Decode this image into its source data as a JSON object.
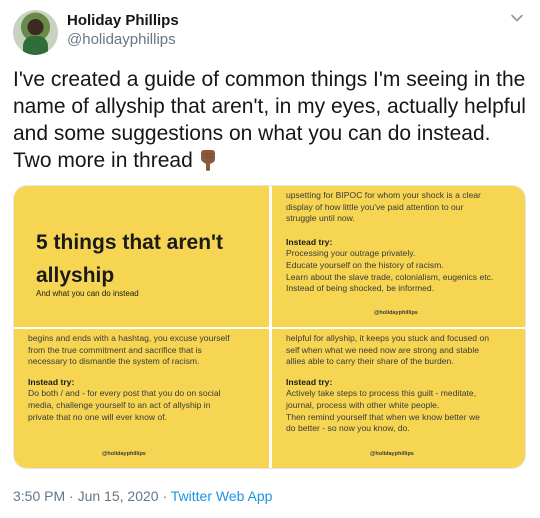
{
  "author": {
    "name": "Holiday Phillips",
    "handle": "@holidayphillips"
  },
  "tweet": {
    "text": "I've created a guide of common things I'm seeing in the name of allyship that aren't, in my eyes, actually helpful and some suggestions on what you can do instead. Two more in thread",
    "emoji": "backhand-index-pointing-down"
  },
  "media": {
    "panel1": {
      "title": "5 things that aren't allyship",
      "subtitle": "And what you can do instead"
    },
    "panel2": {
      "lines": [
        "upsetting for BIPOC for whom your shock is a clear",
        "display of how little you've paid attention to our",
        "struggle until now."
      ],
      "instead_label": "Instead try:",
      "instead_lines": [
        "Processing your outrage privately.",
        "Educate yourself on the history of racism.",
        "Learn about the slave trade, colonialism, eugenics etc.",
        "Instead of being shocked, be informed."
      ],
      "tag": "@holidayphillips"
    },
    "panel3": {
      "lines": [
        "begins and ends with a hashtag, you excuse yourself",
        "from the true commitment and sacrifice that is",
        "necessary to dismantle the system of racism."
      ],
      "instead_label": "Instead try:",
      "instead_lines": [
        "Do both / and - for every post that you do on social",
        "media, challenge yourself to an act of allyship in",
        "private that no one will ever know of."
      ],
      "tag": "@holidayphillips"
    },
    "panel4": {
      "lines": [
        "helpful for allyship, it keeps you stuck and focused on",
        "self when what we need now are strong and stable",
        "allies able to carry their share of the burden."
      ],
      "instead_label": "Instead try:",
      "instead_lines": [
        "Actively take steps to process this guilt - meditate,",
        "journal, process with other white people.",
        "Then remind yourself that when we know better we",
        "do better - so now you know, do."
      ],
      "tag": "@holidayphillips"
    }
  },
  "meta": {
    "time": "3:50 PM",
    "date": "Jun 15, 2020",
    "separator": "·",
    "source": "Twitter Web App"
  },
  "colors": {
    "panel": "#f6d552",
    "link": "#1b95e0",
    "muted": "#657786"
  }
}
